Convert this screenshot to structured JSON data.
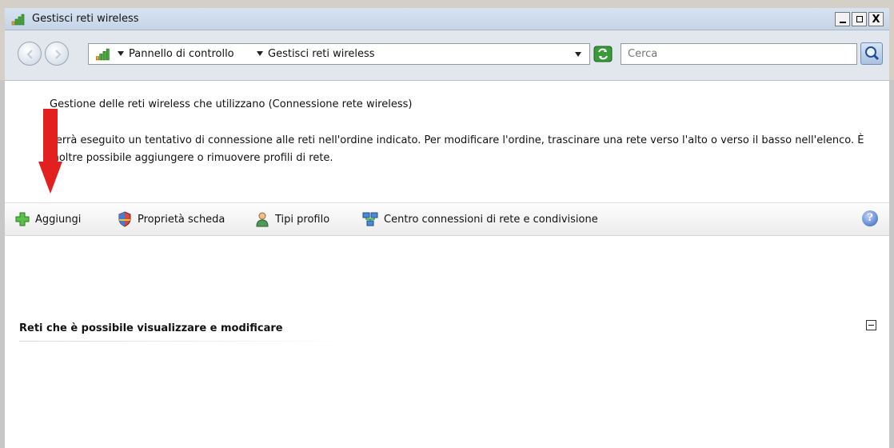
{
  "window": {
    "title": "Gestisci reti wireless",
    "buttons": {
      "minimize": "_",
      "maximize": "□",
      "close": "X"
    }
  },
  "address": {
    "crumbs": [
      "Pannello di controllo",
      "Gestisci reti wireless"
    ],
    "search_placeholder": "Cerca"
  },
  "content": {
    "heading": "Gestione delle reti wireless che utilizzano (Connessione rete wireless)",
    "description": "Verrà eseguito un tentativo di connessione alle reti nell'ordine indicato. Per modificare l'ordine, trascinare una rete verso l'alto o verso il basso nell'elenco. È inoltre possibile aggiungere o rimuovere profili di rete."
  },
  "toolbar": {
    "items": [
      {
        "label": "Aggiungi",
        "icon": "add-icon"
      },
      {
        "label": "Proprietà scheda",
        "icon": "shield-icon"
      },
      {
        "label": "Tipi profilo",
        "icon": "user-icon"
      },
      {
        "label": "Centro connessioni di rete e condivisione",
        "icon": "network-icon"
      }
    ],
    "help": "?"
  },
  "list": {
    "section_title": "Reti che è possibile visualizzare e modificare"
  },
  "colors": {
    "titlebar": "#d7e3f1",
    "accent_red": "#e32020",
    "toolbar_bg": "#f3f3f3"
  }
}
